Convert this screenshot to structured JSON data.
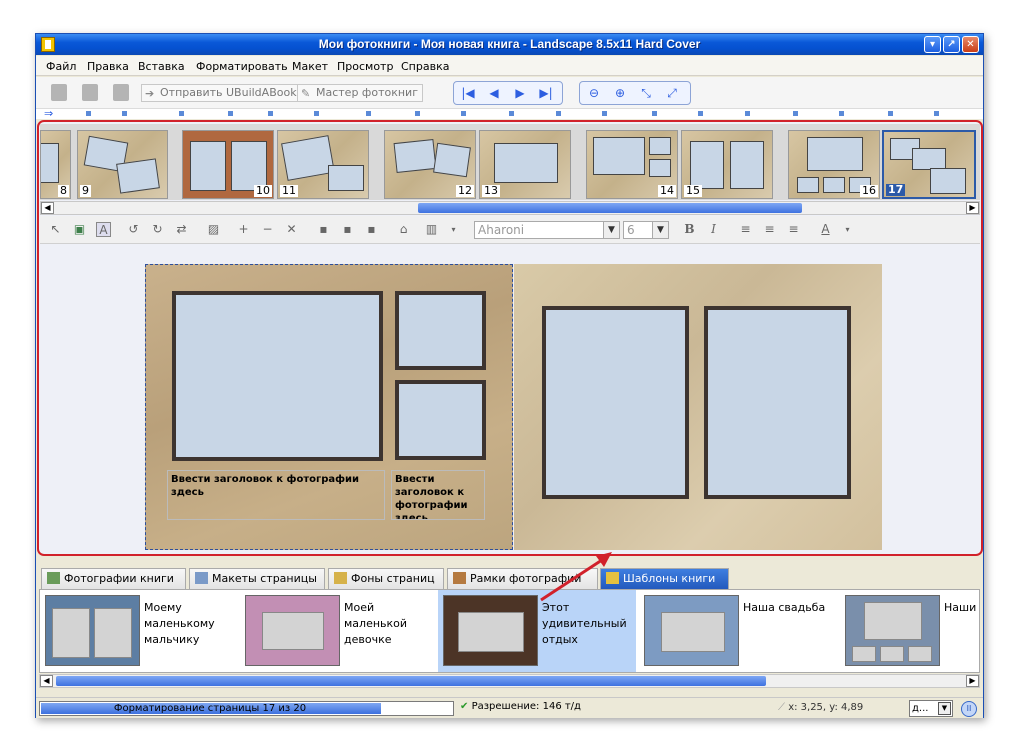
{
  "window": {
    "title": "Мои фотокниги - Моя новая книга - Landscape 8.5x11 Hard Cover",
    "controls": {
      "minimize": "▾",
      "restore": "↗",
      "close": "✕"
    }
  },
  "menu": [
    "Файл",
    "Правка",
    "Вставка",
    "Форматировать",
    "Макет",
    "Просмотр",
    "Справка"
  ],
  "toolbar": {
    "send_label": "Отправить  UBuildABook",
    "wizard_label": "Мастер фотокниг",
    "nav_icons": [
      "first-page-icon",
      "prev-page-icon",
      "next-page-icon",
      "last-page-icon"
    ],
    "zoom_icons": [
      "zoom-out-icon",
      "zoom-in-icon",
      "fit-icon",
      "fullscreen-icon"
    ]
  },
  "filmstrip": {
    "thumbnails": [
      {
        "num": "8"
      },
      {
        "num": "9"
      },
      {
        "num": "10"
      },
      {
        "num": "11"
      },
      {
        "num": "12"
      },
      {
        "num": "13"
      },
      {
        "num": "14"
      },
      {
        "num": "15"
      },
      {
        "num": "16"
      },
      {
        "num": "17",
        "selected": true
      }
    ]
  },
  "edit_toolbar": {
    "font": "Aharoni",
    "font_size": "6",
    "bold": "B",
    "italic": "I",
    "font_color": "A"
  },
  "page": {
    "caption_left": "Ввести заголовок к фотографии здесь",
    "caption_right": "Ввести заголовок к фотографии здесь"
  },
  "tabs": [
    {
      "label": "Фотографии книги",
      "icon": "photos-icon",
      "active": false
    },
    {
      "label": "Макеты страницы",
      "icon": "layouts-icon",
      "active": false
    },
    {
      "label": "Фоны страниц",
      "icon": "backgrounds-icon",
      "active": false
    },
    {
      "label": "Рамки фотографий",
      "icon": "frames-icon",
      "active": false
    },
    {
      "label": "Шаблоны книги",
      "icon": "templates-icon",
      "active": true
    }
  ],
  "templates": [
    {
      "label": "Моему маленькому мальчику",
      "bg": "#5d7ea3"
    },
    {
      "label": "Моей маленькой девочке",
      "bg": "#c28fb4"
    },
    {
      "label": "Этот удивительный отдых",
      "bg": "#4c3426",
      "selected": true
    },
    {
      "label": "Наша свадьба",
      "bg": "#7d9bc2"
    },
    {
      "label": "Наши",
      "bg": "#7a8fab"
    }
  ],
  "status": {
    "progress_text": "Форматирование страницы 17 из 20",
    "progress": 0.85,
    "resolution": "Разрешение: 146 т/д",
    "coords": "x: 3,25, y: 4,89",
    "unit": "д...",
    "pause": "II"
  },
  "colors": {
    "titlebar": "#0a58d8",
    "highlight_frame": "#d1212a",
    "selection": "#b9d4f8",
    "photo_placeholder": "#c8d6e6"
  }
}
